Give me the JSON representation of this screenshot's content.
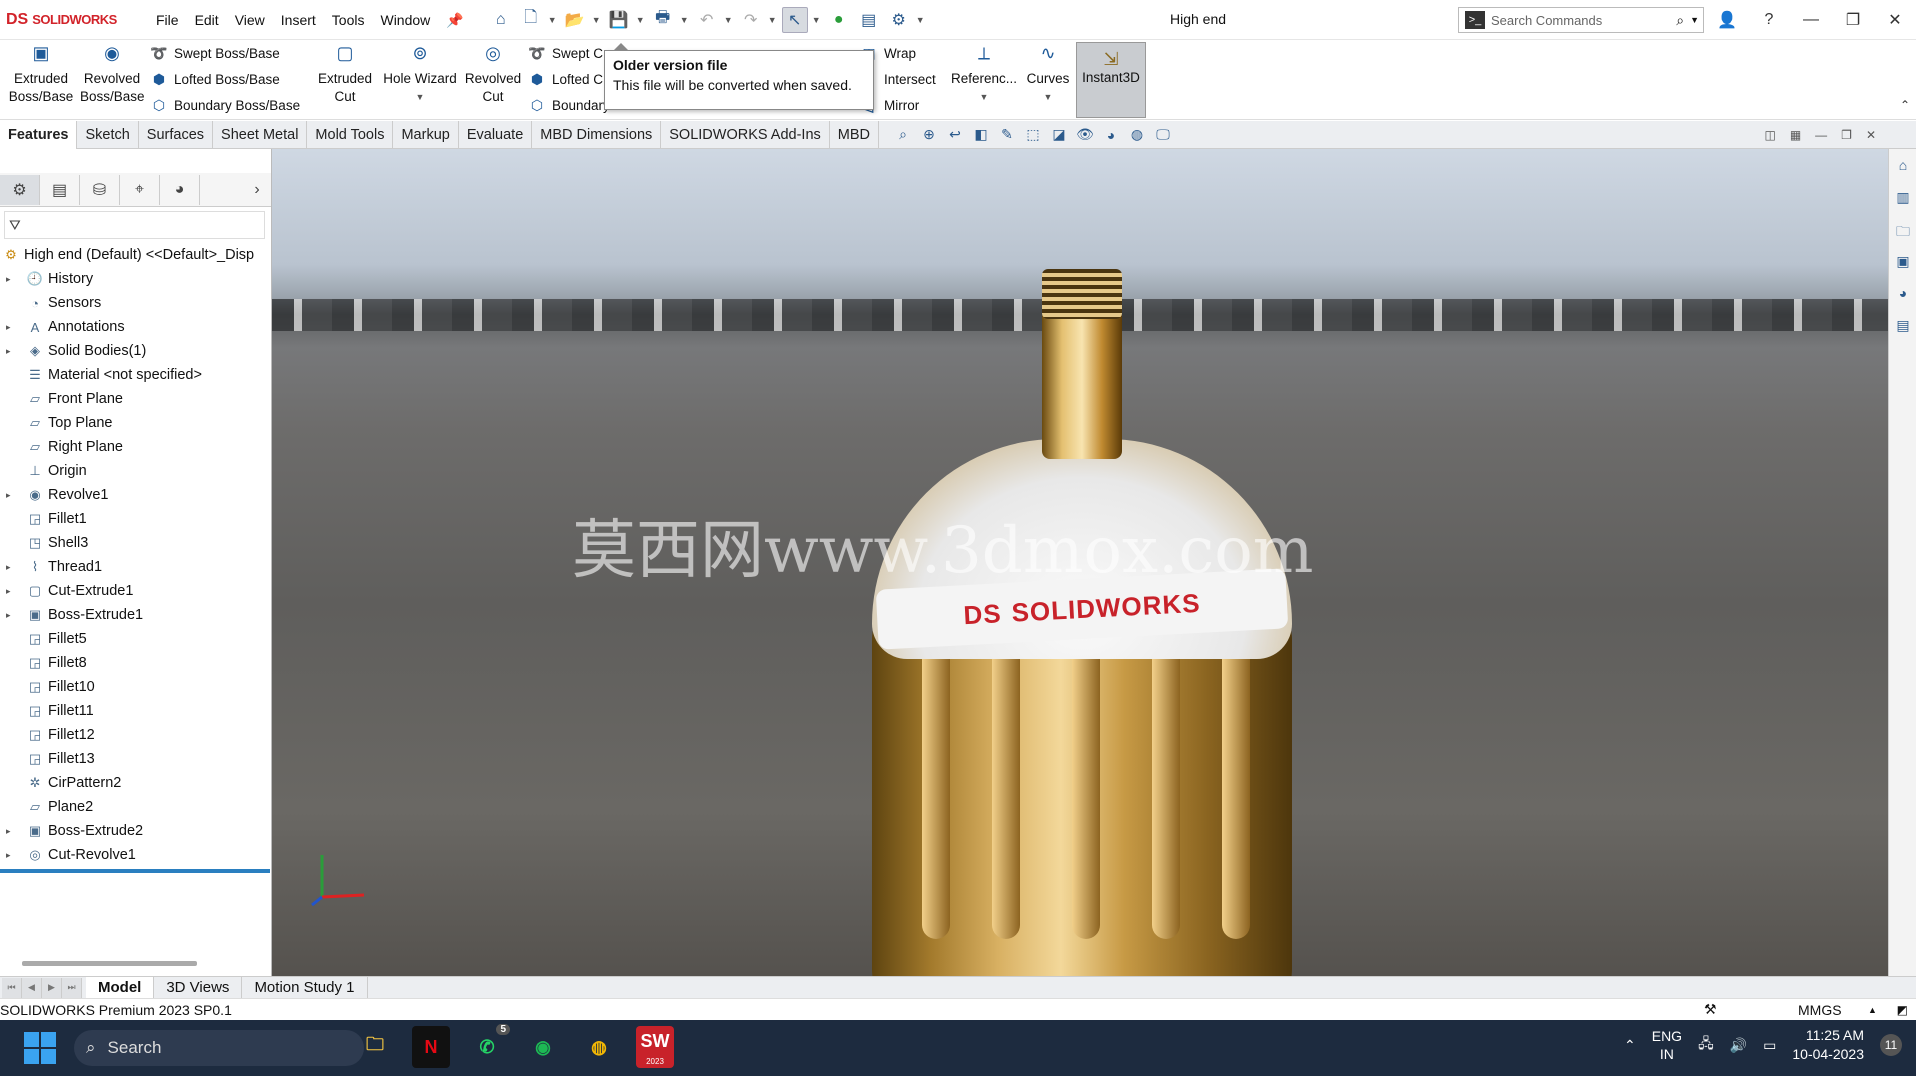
{
  "app": {
    "brand_mark": "DS",
    "brand": "SOLIDWORKS",
    "document_title": "High end"
  },
  "menu": [
    "File",
    "Edit",
    "View",
    "Insert",
    "Tools",
    "Window"
  ],
  "search": {
    "placeholder": "Search Commands"
  },
  "ribbon": {
    "extruded_boss": "Extruded Boss/Base",
    "revolved_boss": "Revolved Boss/Base",
    "swept_boss": "Swept Boss/Base",
    "lofted_boss": "Lofted Boss/Base",
    "boundary_boss": "Boundary Boss/Base",
    "extruded_cut": "Extruded Cut",
    "hole_wizard": "Hole Wizard",
    "revolved_cut": "Revolved Cut",
    "swept_cut": "Swept C",
    "lofted_cut": "Lofted C",
    "boundary_cut": "Boundary",
    "wrap": "Wrap",
    "intersect": "Intersect",
    "mirror": "Mirror",
    "reference": "Referenc...",
    "curves": "Curves",
    "instant3d": "Instant3D"
  },
  "tooltip": {
    "title": "Older version file",
    "body": "This file will be converted when saved."
  },
  "tabs": [
    "Features",
    "Sketch",
    "Surfaces",
    "Sheet Metal",
    "Mold Tools",
    "Markup",
    "Evaluate",
    "MBD Dimensions",
    "SOLIDWORKS Add-Ins",
    "MBD"
  ],
  "tree": {
    "root": "High end (Default) <<Default>_Disp",
    "items": [
      "History",
      "Sensors",
      "Annotations",
      "Solid Bodies(1)",
      "Material <not specified>",
      "Front Plane",
      "Top Plane",
      "Right Plane",
      "Origin",
      "Revolve1",
      "Fillet1",
      "Shell3",
      "Thread1",
      "Cut-Extrude1",
      "Boss-Extrude1",
      "Fillet5",
      "Fillet8",
      "Fillet10",
      "Fillet11",
      "Fillet12",
      "Fillet13",
      "CirPattern2",
      "Plane2",
      "Boss-Extrude2",
      "Cut-Revolve1"
    ]
  },
  "viewport": {
    "label_text": "SOLIDWORKS",
    "label_mark": "DS",
    "watermark": "莫西网www.3dmox.com"
  },
  "bottom_tabs": [
    "Model",
    "3D Views",
    "Motion Study 1"
  ],
  "status": {
    "text": "SOLIDWORKS Premium 2023 SP0.1",
    "units": "MMGS"
  },
  "taskbar": {
    "search": "Search",
    "lang1": "ENG",
    "lang2": "IN",
    "time": "11:25 AM",
    "date": "10-04-2023",
    "whatsapp_badge": "5",
    "sw_icon": "SW",
    "sw_version": "2023",
    "notifications": "11"
  }
}
